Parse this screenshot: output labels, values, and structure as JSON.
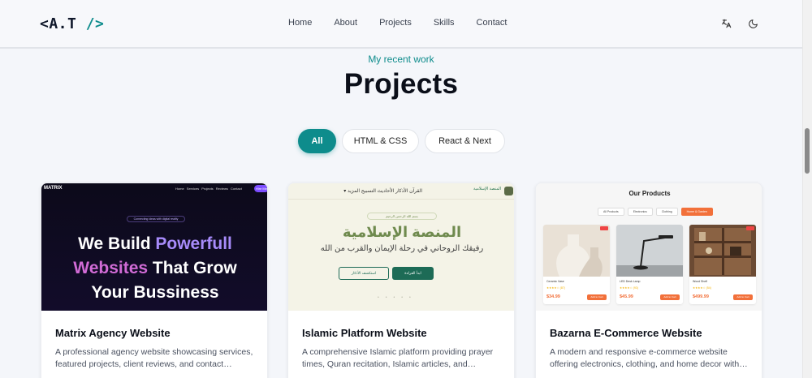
{
  "header": {
    "logo_prefix": "<",
    "logo_text": "A.T",
    "logo_suffix": " />",
    "nav": [
      "Home",
      "About",
      "Projects",
      "Skills",
      "Contact"
    ],
    "icons": [
      "translate-icon",
      "moon-icon"
    ]
  },
  "section": {
    "subtitle": "My recent work",
    "title": "Projects"
  },
  "filters": {
    "items": [
      "All",
      "HTML & CSS",
      "React & Next"
    ],
    "active": "All"
  },
  "projects": [
    {
      "title": "Matrix Agency Website",
      "description": "A professional agency website showcasing services, featured projects, client reviews, and contact…",
      "preview": {
        "brand": "MATRIX",
        "links": "Home  Services  Projects  Reviews  Contact",
        "cta": "Hire Me",
        "pill": "Connecting ideas with digital reality",
        "heading_1a": "We Build ",
        "heading_1b": "Powerfull",
        "heading_2a": "Websites",
        "heading_2b": " That Grow",
        "heading_3": "Your Bussiness"
      }
    },
    {
      "title": "Islamic Platform Website",
      "description": "A comprehensive Islamic platform providing prayer times, Quran recitation, Islamic articles, and…",
      "preview": {
        "brand": "المنصة الإسلامية",
        "nav": "القرآن   الأذكار   الأحاديث   التسبيح   المزيد ▾",
        "pill": "بسم الله الرحمن الرحيم",
        "heading": "المنصة الإسلامية",
        "subheading": "رفيقك الروحاني في رحلة الإيمان والقرب من الله",
        "button_primary": "ابدأ القراءة",
        "button_secondary": "استكشف الأذكار"
      }
    },
    {
      "title": "Bazarna E-Commerce Website",
      "description": "A modern and responsive e-commerce website offering electronics, clothing, and home decor with…",
      "preview": {
        "heading": "Our Products",
        "filters": [
          "All Products",
          "Electronics",
          "Clothing",
          "Home & Garden"
        ],
        "products": [
          {
            "name": "Ceramic Vase",
            "price": "$34.99",
            "stars": "★★★★☆ (87)",
            "add": "Add to Cart"
          },
          {
            "name": "LED Desk Lamp",
            "price": "$45.99",
            "stars": "★★★★☆ (93)",
            "add": "Add to Cart"
          },
          {
            "name": "Wood Shelf",
            "price": "$499.99",
            "stars": "★★★★☆ (54)",
            "add": "Add to Cart"
          }
        ]
      }
    }
  ],
  "colors": {
    "accent": "#0e8c8c",
    "page_bg": "#f4f6fa",
    "matrix_purple": "#a78bfa",
    "islamic_green": "#6f8a4e",
    "bazarna_orange": "#f2703a"
  }
}
